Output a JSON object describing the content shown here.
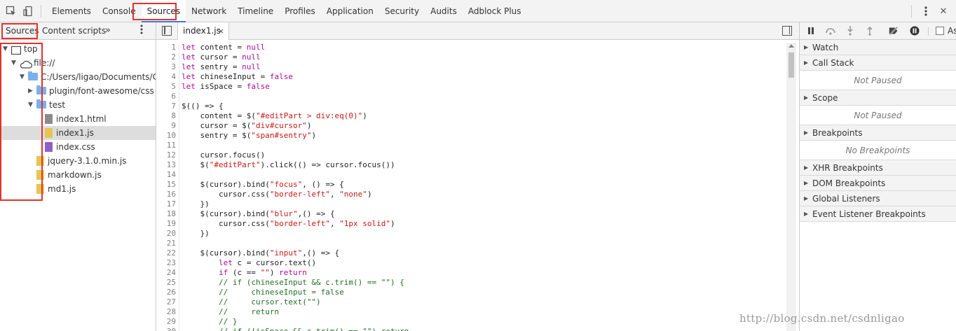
{
  "toolbar": {
    "tabs": [
      "Elements",
      "Console",
      "Sources",
      "Network",
      "Timeline",
      "Profiles",
      "Application",
      "Security",
      "Audits",
      "Adblock Plus"
    ],
    "active_tab": "Sources"
  },
  "navigator": {
    "tabs": [
      "Sources",
      "Content scripts"
    ],
    "more": "»",
    "tree": [
      {
        "label": "top",
        "icon": "frame-icon",
        "depth": 0,
        "expanded": true
      },
      {
        "label": "file://",
        "icon": "cloud-icon",
        "depth": 1,
        "expanded": true
      },
      {
        "label": "C:/Users/ligao/Documents/Code",
        "icon": "folder-icon",
        "depth": 2,
        "expanded": true
      },
      {
        "label": "plugin/font-awesome/css",
        "icon": "folder-icon",
        "depth": 3,
        "expanded": false
      },
      {
        "label": "test",
        "icon": "folder-icon",
        "depth": 3,
        "expanded": true
      },
      {
        "label": "index1.html",
        "icon": "html-file-icon",
        "depth": 4
      },
      {
        "label": "index1.js",
        "icon": "js-file-icon",
        "depth": 4,
        "selected": true
      },
      {
        "label": "index.css",
        "icon": "css-file-icon",
        "depth": 4
      },
      {
        "label": "jquery-3.1.0.min.js",
        "icon": "js-file-icon",
        "depth": 3
      },
      {
        "label": "markdown.js",
        "icon": "js-file-icon",
        "depth": 3
      },
      {
        "label": "md1.js",
        "icon": "js-file-icon",
        "depth": 3
      }
    ]
  },
  "editor": {
    "open_file": "index1.js",
    "close": "×",
    "lines": [
      "let content = null",
      "let cursor = null",
      "let sentry = null",
      "let chineseInput = false",
      "let isSpace = false",
      "",
      "$(() => {",
      "    content = $(\"#editPart > div:eq(0)\")",
      "    cursor = $(\"div#cursor\")",
      "    sentry = $(\"span#sentry\")",
      "",
      "    cursor.focus()",
      "    $(\"#editPart\").click(() => cursor.focus())",
      "",
      "    $(cursor).bind(\"focus\", () => {",
      "        cursor.css(\"border-left\", \"none\")",
      "    })",
      "    $(cursor).bind(\"blur\",() => {",
      "        cursor.css(\"border-left\", \"1px solid\")",
      "    })",
      "",
      "    $(cursor).bind(\"input\",() => {",
      "        let c = cursor.text()",
      "        if (c == \"\") return",
      "        // if (chineseInput && c.trim() == \"\") {",
      "        //     chineseInput = false",
      "        //     cursor.text(\"\")",
      "        //     return",
      "        // }",
      "        // if (!isSpace && c.trim() == \"\") return"
    ]
  },
  "debugger": {
    "async_label": "Async",
    "sections": [
      {
        "title": "Watch"
      },
      {
        "title": "Call Stack",
        "body": "Not Paused"
      },
      {
        "title": "Scope",
        "body": "Not Paused"
      },
      {
        "title": "Breakpoints",
        "body": "No Breakpoints"
      },
      {
        "title": "XHR Breakpoints"
      },
      {
        "title": "DOM Breakpoints"
      },
      {
        "title": "Global Listeners"
      },
      {
        "title": "Event Listener Breakpoints"
      }
    ]
  },
  "watermark": "http://blog.csdn.net/csdnligao",
  "colors": {
    "highlight_box": "#e0332e",
    "keyword": "#aa0d91",
    "string": "#c41a16",
    "comment": "#236e25"
  }
}
